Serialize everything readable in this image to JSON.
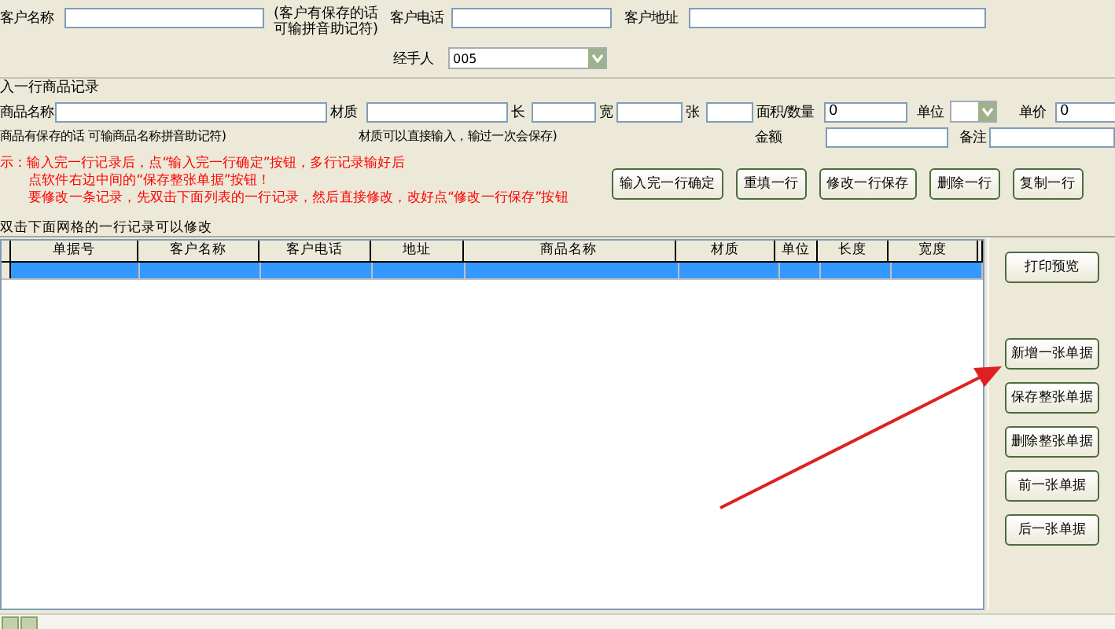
{
  "header_fields": [
    {
      "label": "客户名称"
    },
    {
      "label": "客户电话"
    },
    {
      "label": "客户地址"
    }
  ],
  "customer_note": [
    "(客户有保存的话",
    "可输拼音助记符)"
  ],
  "handler": {
    "label": "经手人",
    "value": "005"
  },
  "entry_group": {
    "title": "入一行商品记录",
    "fields": [
      {
        "label": "商品名称",
        "kind": "input"
      },
      {
        "label": "材质",
        "kind": "input"
      },
      {
        "label": "长",
        "kind": "input"
      },
      {
        "label": "宽",
        "kind": "input"
      },
      {
        "label": "张",
        "kind": "input"
      },
      {
        "label": "面积/数量",
        "kind": "input",
        "value": "0"
      },
      {
        "label": "单位",
        "kind": "select"
      },
      {
        "label": "单价",
        "kind": "input",
        "value": "0"
      }
    ],
    "hints": [
      "商品有保存的话  可输商品名称拼音助记符)",
      "材质可以直接输入，输过一次会保存)"
    ],
    "amount_fields": [
      {
        "label": "金额"
      },
      {
        "label": "备注"
      }
    ],
    "tips": [
      "示：输入完一行记录后，点“输入完一行确定”按钮，多行记录输好后",
      "点软件右边中间的“保存整张单据”按钮！",
      "要修改一条记录，先双击下面列表的一行记录，然后直接修改，改好点“修改一行保存”按钮"
    ],
    "buttons": [
      "输入完一行确定",
      "重填一行",
      "修改一行保存",
      "删除一行",
      "复制一行"
    ]
  },
  "grid": {
    "caption": "双击下面网格的一行记录可以修改",
    "columns": [
      "单据号",
      "客户名称",
      "客户电话",
      "地址",
      "商品名称",
      "材质",
      "单位",
      "长度",
      "宽度"
    ],
    "rows": [
      {
        "selected": true
      }
    ]
  },
  "side_buttons": [
    "打印预览",
    "新增一张单据",
    "保存整张单据",
    "删除整张单据",
    "前一张单据",
    "后一张单据"
  ]
}
